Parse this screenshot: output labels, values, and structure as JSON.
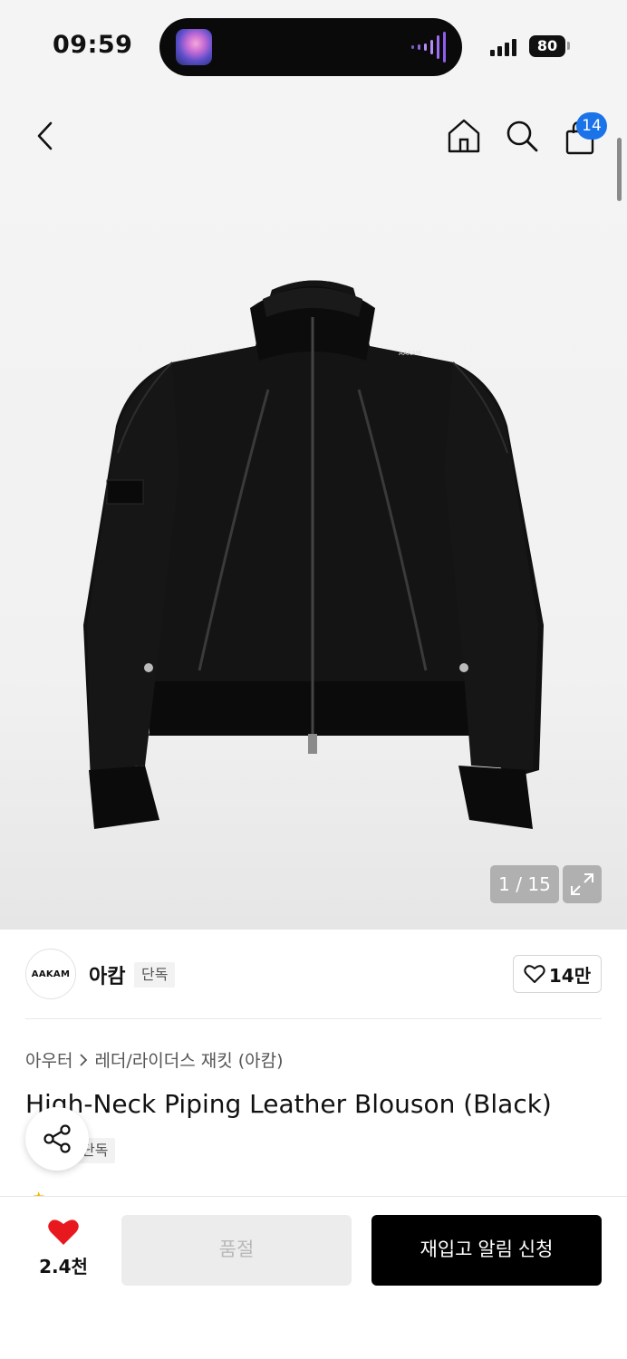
{
  "status_bar": {
    "time": "09:59",
    "battery": "80"
  },
  "nav": {
    "back_icon": "chevron-left-icon",
    "home_icon": "home-icon",
    "search_icon": "search-icon",
    "cart_icon": "shopping-bag-icon",
    "cart_badge": "14"
  },
  "gallery": {
    "counter": "1 / 15",
    "expand_icon": "expand-icon",
    "image_logo": "AAKAM"
  },
  "brand": {
    "logo_text": "AAKAM",
    "name": "아캄",
    "tag": "단독",
    "like_count": "14만"
  },
  "breadcrumb": {
    "category": "아우터",
    "subcategory": "레더/라이더스 재킷 (아캄)"
  },
  "product": {
    "title": "High-Neck Piping Leather Blouson (Black)",
    "tag": "단독"
  },
  "bottom_bar": {
    "wish_count": "2.4천",
    "soldout_label": "품절",
    "restock_label": "재입고 알림 신청"
  },
  "colors": {
    "accent_blue": "#1a73e8",
    "heart_red": "#e8191e",
    "primary_button": "#000000",
    "disabled_button": "#ececec"
  }
}
